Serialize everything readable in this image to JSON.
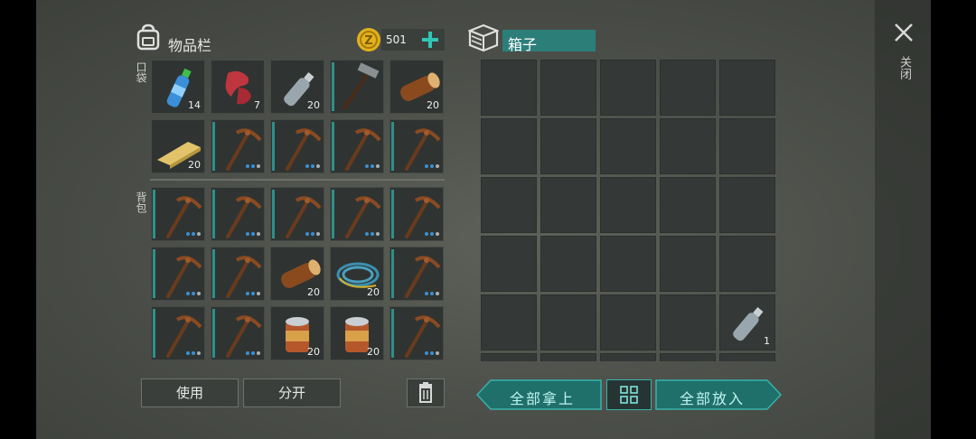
{
  "inventory": {
    "title": "物品栏",
    "coins": "501",
    "section_pocket": "口袋",
    "section_backpack": "背包",
    "use_label": "使用",
    "split_label": "分开",
    "pocket": [
      {
        "icon": "water-bottle-icon",
        "count": "14"
      },
      {
        "icon": "raw-meat-icon",
        "count": "7"
      },
      {
        "icon": "empty-bottle-icon",
        "count": "20"
      },
      {
        "icon": "hammer-icon",
        "count": ""
      },
      {
        "icon": "log-icon",
        "count": "20"
      },
      {
        "icon": "plank-icon",
        "count": "20"
      },
      {
        "icon": "pickaxe-icon",
        "count": ""
      },
      {
        "icon": "pickaxe-icon",
        "count": ""
      },
      {
        "icon": "pickaxe-icon",
        "count": ""
      },
      {
        "icon": "pickaxe-icon",
        "count": ""
      }
    ],
    "backpack": [
      {
        "icon": "pickaxe-icon",
        "count": ""
      },
      {
        "icon": "pickaxe-icon",
        "count": ""
      },
      {
        "icon": "pickaxe-icon",
        "count": ""
      },
      {
        "icon": "pickaxe-icon",
        "count": ""
      },
      {
        "icon": "pickaxe-icon",
        "count": ""
      },
      {
        "icon": "pickaxe-icon",
        "count": ""
      },
      {
        "icon": "pickaxe-icon",
        "count": ""
      },
      {
        "icon": "log-icon",
        "count": "20"
      },
      {
        "icon": "rope-icon",
        "count": "20"
      },
      {
        "icon": "pickaxe-icon",
        "count": ""
      },
      {
        "icon": "pickaxe-icon",
        "count": ""
      },
      {
        "icon": "pickaxe-icon",
        "count": ""
      },
      {
        "icon": "tin-can-icon",
        "count": "20"
      },
      {
        "icon": "tin-can-icon",
        "count": "20"
      },
      {
        "icon": "pickaxe-icon",
        "count": ""
      }
    ]
  },
  "box": {
    "title": "箱子",
    "bottle_count": "1",
    "take_all_label": "全部拿上",
    "put_all_label": "全部放入"
  },
  "close_label": "关闭",
  "colors": {
    "accent": "#2e8f8a",
    "button_teal": "#1f6f6b",
    "coin": "#e3b21c"
  }
}
